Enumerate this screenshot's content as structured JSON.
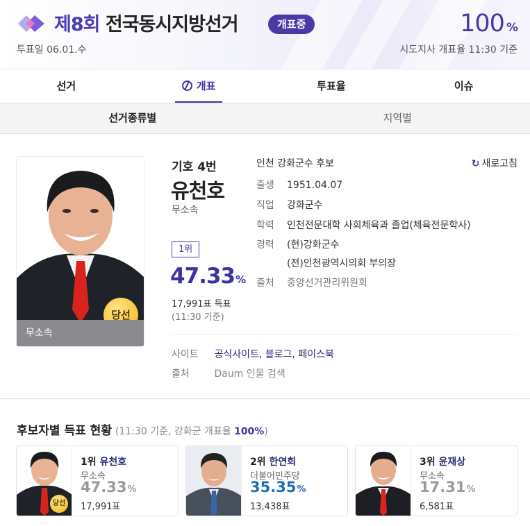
{
  "header": {
    "title_num": "제8회",
    "title_rest": "전국동시지방선거",
    "badge": "개표중",
    "vote_date": "투표일 06.01.수",
    "count_rate": "100",
    "count_rate_unit": "%",
    "count_rate_label": "시도지사 개표율 11:30 기준",
    "accent": "#4a3aa8"
  },
  "tabs": [
    {
      "label": "선거"
    },
    {
      "label": "개표",
      "icon": "ballot-icon",
      "active": true
    },
    {
      "label": "투표율"
    },
    {
      "label": "이슈"
    }
  ],
  "subtabs": [
    {
      "label": "선거종류별",
      "active": true
    },
    {
      "label": "지역별"
    }
  ],
  "candidate": {
    "number": "기호 4번",
    "name": "유천호",
    "party": "무소속",
    "rank": "1위",
    "percent": "47.33",
    "percent_unit": "%",
    "votes": "17,991표 득표",
    "time": "(11:30 기준)",
    "photo_party": "무소속",
    "win_label": "당선",
    "headline": "인천 강화군수 후보",
    "refresh": "새로고침",
    "info": [
      {
        "k": "출생",
        "v": "1951.04.07"
      },
      {
        "k": "직업",
        "v": "강화군수"
      },
      {
        "k": "학력",
        "v": "인천전문대학 사회체육과 졸업(체육전문학사)"
      },
      {
        "k": "경력",
        "v": "(현)강화군수"
      },
      {
        "k": "",
        "v": "(전)인천광역시의회 부의장"
      },
      {
        "k": "출처",
        "v": "중앙선거관리위원회"
      }
    ],
    "site_label": "사이트",
    "site_links": [
      "공식사이트",
      "블로그",
      "페이스북"
    ],
    "site_sep": ", ",
    "source_label": "출처",
    "source_value": "Daum 인물 검색"
  },
  "results": {
    "title": "후보자별 득표 현황",
    "meta_prefix": "(11:30 기준, 강화군 개표율 ",
    "meta_rate": "100%",
    "meta_suffix": ")",
    "cards": [
      {
        "rank": "1위",
        "name": "유천호",
        "party": "무소속",
        "percent": "47.33",
        "unit": "%",
        "votes": "17,991표",
        "win": "당선",
        "color": "#9a9a9a"
      },
      {
        "rank": "2위",
        "name": "한연희",
        "party": "더불어민주당",
        "percent": "35.35",
        "unit": "%",
        "votes": "13,438표",
        "color": "#1a6fb8"
      },
      {
        "rank": "3위",
        "name": "윤재상",
        "party": "무소속",
        "percent": "17.31",
        "unit": "%",
        "votes": "6,581표",
        "color": "#9a9a9a"
      }
    ]
  }
}
